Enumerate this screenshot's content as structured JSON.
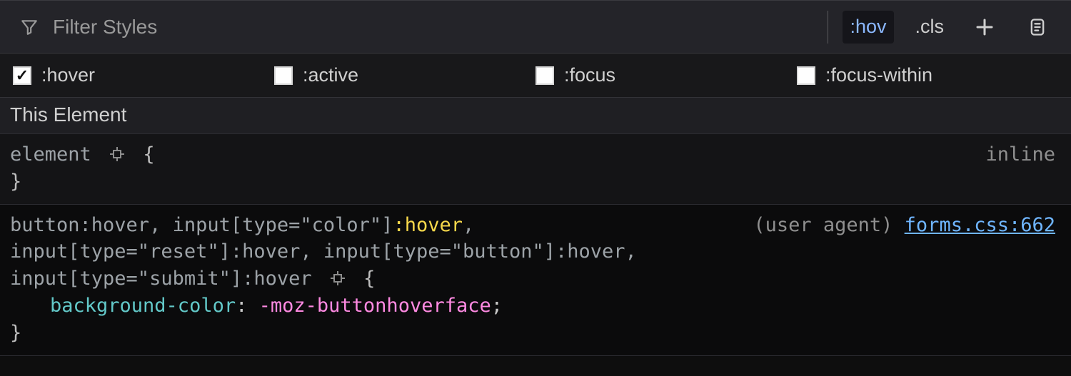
{
  "toolbar": {
    "filter_placeholder": "Filter Styles",
    "hov_label": ":hov",
    "cls_label": ".cls"
  },
  "pseudo": {
    "items": [
      {
        "label": ":hover",
        "checked": true
      },
      {
        "label": ":active",
        "checked": false
      },
      {
        "label": ":focus",
        "checked": false
      },
      {
        "label": ":focus-within",
        "checked": false
      }
    ]
  },
  "section": {
    "heading": "This Element"
  },
  "rules": [
    {
      "selector_plain": "element",
      "origin_label": "inline",
      "declarations": []
    },
    {
      "selector_parts": [
        {
          "text": "button:hover, input[type=\"color\"]",
          "match": false
        },
        {
          "text": ":hover",
          "match": true
        },
        {
          "text": ",",
          "match": false
        }
      ],
      "selector_line2": "input[type=\"reset\"]:hover, input[type=\"button\"]:hover,",
      "selector_line3": "input[type=\"submit\"]:hover",
      "origin_ua": "(user agent)",
      "origin_file": "forms.css:662",
      "declarations": [
        {
          "property": "background-color",
          "value": "-moz-buttonhoverface"
        }
      ]
    }
  ],
  "glyphs": {
    "open_brace": "{",
    "close_brace": "}",
    "colon": ":",
    "semicolon": ";",
    "check": "✓"
  }
}
